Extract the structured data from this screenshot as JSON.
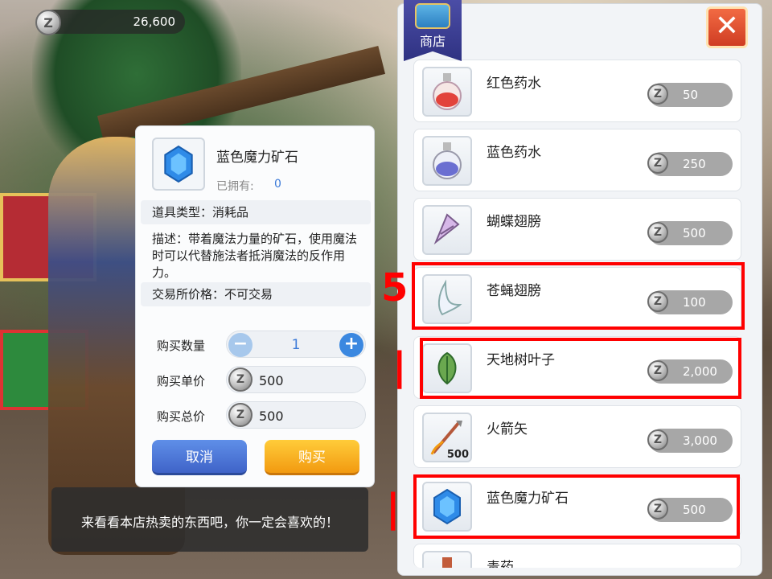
{
  "currency": {
    "amount": "26,600",
    "icon": "zeny-coin-icon"
  },
  "shop": {
    "title": "商店",
    "close_label": "✕",
    "items": [
      {
        "name": "红色药水",
        "price": "50",
        "icon": "red-potion-icon"
      },
      {
        "name": "蓝色药水",
        "price": "250",
        "icon": "blue-potion-icon"
      },
      {
        "name": "蝴蝶翅膀",
        "price": "500",
        "icon": "butterfly-wing-icon"
      },
      {
        "name": "苍蝇翅膀",
        "price": "100",
        "icon": "fly-wing-icon"
      },
      {
        "name": "天地树叶子",
        "price": "2,000",
        "icon": "yggdrasil-leaf-icon"
      },
      {
        "name": "火箭矢",
        "price": "3,000",
        "icon": "fire-arrow-icon",
        "stack": "500"
      },
      {
        "name": "蓝色魔力矿石",
        "price": "500",
        "icon": "blue-gemstone-icon"
      },
      {
        "name": "毒药",
        "price": "",
        "icon": "poison-icon"
      }
    ],
    "annotations": {
      "mark_fly": "5",
      "mark_leaf": "|",
      "mark_gem": "|"
    }
  },
  "detail": {
    "title": "蓝色魔力矿石",
    "owned_label": "已拥有:",
    "owned_value": "0",
    "type_text": "道具类型：消耗品",
    "description": "描述：带着魔法力量的矿石，使用魔法时可以代替施法者抵消魔法的反作用力。",
    "trade_text": "交易所价格：不可交易",
    "quantity_label": "购买数量",
    "quantity_value": "1",
    "unit_price_label": "购买单价",
    "unit_price_value": "500",
    "total_price_label": "购买总价",
    "total_price_value": "500",
    "cancel_label": "取消",
    "buy_label": "购买"
  },
  "npc": {
    "text": "来看看本店热卖的东西吧，你一定会喜欢的！"
  }
}
